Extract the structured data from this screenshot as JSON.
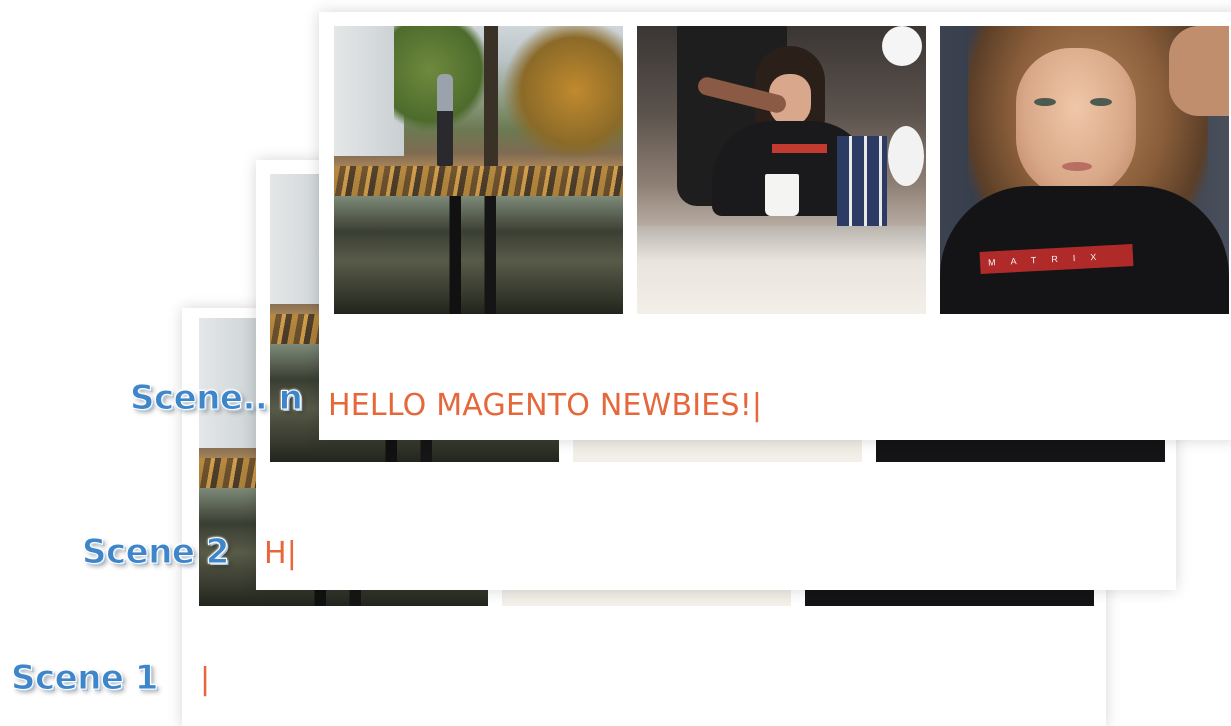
{
  "scenes": [
    {
      "label": "Scene 1",
      "typed_text": "|"
    },
    {
      "label": "Scene 2",
      "typed_text": "H|"
    },
    {
      "label": "Scene.. n",
      "typed_text": "HELLO MAGENTO NEWBIES!|"
    }
  ],
  "colors": {
    "typed_text": "#e5673a",
    "scene_label": "#3e86c9",
    "card_background": "#ffffff"
  },
  "photos": [
    {
      "subject": "park-puddle-reflection"
    },
    {
      "subject": "salon-hairdressing"
    },
    {
      "subject": "model-portrait"
    }
  ]
}
